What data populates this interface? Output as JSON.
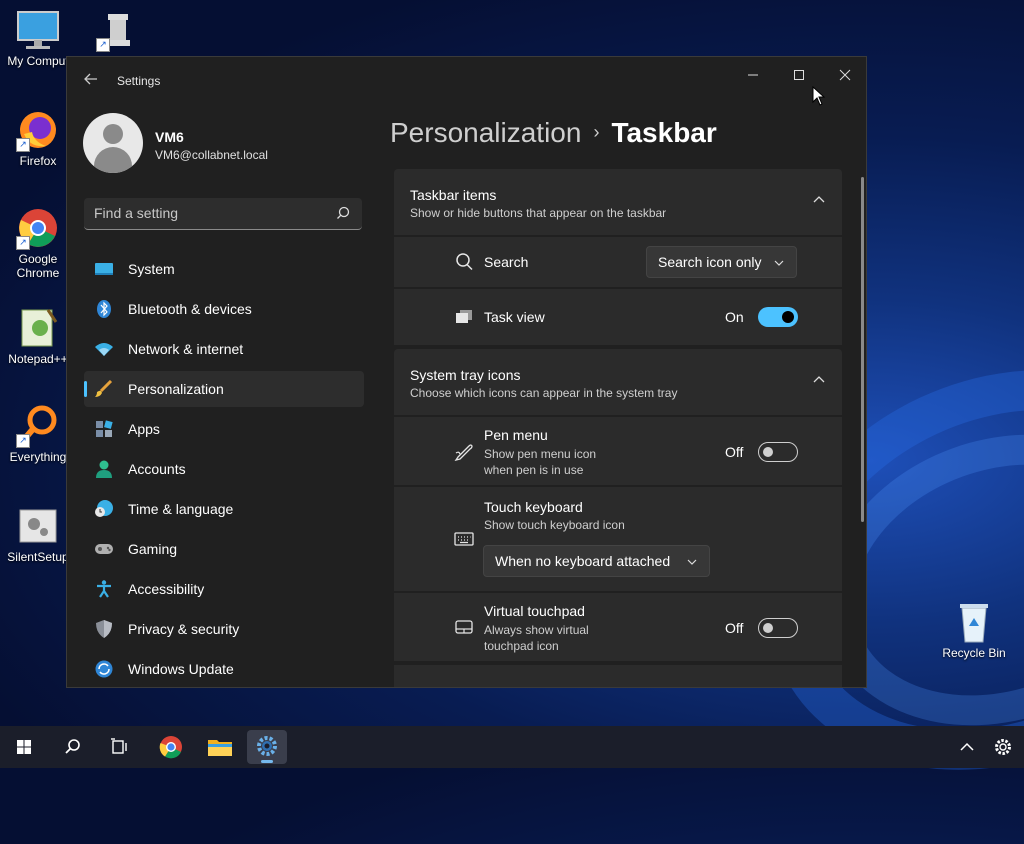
{
  "desktop": {
    "icons": [
      {
        "label": "My Comput",
        "icon": "monitor-icon"
      },
      {
        "label": "",
        "icon": "chess-rook-icon"
      },
      {
        "label": "Firefox",
        "icon": "firefox-icon"
      },
      {
        "label": "Google\nChrome",
        "icon": "chrome-icon"
      },
      {
        "label": "Notepad++",
        "icon": "notepadpp-icon"
      },
      {
        "label": "Everything",
        "icon": "everything-icon"
      },
      {
        "label": "SilentSetup",
        "icon": "setup-icon"
      },
      {
        "label": "Recycle Bin",
        "icon": "recycle-bin-icon"
      }
    ]
  },
  "window": {
    "title": "Settings",
    "controls": {
      "minimize": "—",
      "maximize": "☐",
      "close": "✕"
    }
  },
  "profile": {
    "name": "VM6",
    "email": "VM6@collabnet.local"
  },
  "search": {
    "placeholder": "Find a setting"
  },
  "nav": {
    "items": [
      {
        "label": "System",
        "icon": "system-icon"
      },
      {
        "label": "Bluetooth & devices",
        "icon": "bluetooth-icon"
      },
      {
        "label": "Network & internet",
        "icon": "wifi-icon"
      },
      {
        "label": "Personalization",
        "icon": "brush-icon",
        "active": true
      },
      {
        "label": "Apps",
        "icon": "apps-icon"
      },
      {
        "label": "Accounts",
        "icon": "person-icon"
      },
      {
        "label": "Time & language",
        "icon": "clock-globe-icon"
      },
      {
        "label": "Gaming",
        "icon": "gamepad-icon"
      },
      {
        "label": "Accessibility",
        "icon": "accessibility-icon"
      },
      {
        "label": "Privacy & security",
        "icon": "shield-icon"
      },
      {
        "label": "Windows Update",
        "icon": "update-icon"
      }
    ]
  },
  "breadcrumb": {
    "parent": "Personalization",
    "separator": "›",
    "current": "Taskbar"
  },
  "sections": {
    "taskbar_items": {
      "title": "Taskbar items",
      "subtitle": "Show or hide buttons that appear on the taskbar",
      "search": {
        "label": "Search",
        "value": "Search icon only"
      },
      "task_view": {
        "label": "Task view",
        "state": "On"
      }
    },
    "system_tray": {
      "title": "System tray icons",
      "subtitle": "Choose which icons can appear in the system tray",
      "pen_menu": {
        "label": "Pen menu",
        "sub1": "Show pen menu icon",
        "sub2": "when pen is in use",
        "state": "Off"
      },
      "touch_keyboard": {
        "label": "Touch keyboard",
        "sub": "Show touch keyboard icon",
        "value": "When no keyboard attached"
      },
      "virtual_touchpad": {
        "label": "Virtual touchpad",
        "sub1": "Always show virtual",
        "sub2": "touchpad icon",
        "state": "Off"
      }
    }
  },
  "colors": {
    "accent": "#4cc2ff",
    "window_bg": "#202020",
    "card_bg": "#2b2b2b"
  }
}
